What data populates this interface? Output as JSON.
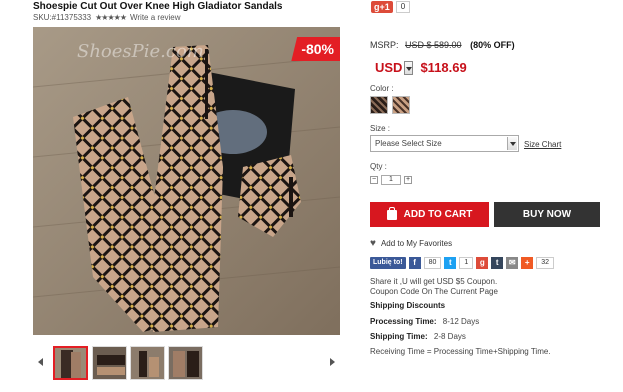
{
  "product": {
    "title": "Shoespie Cut Out Over Knee High Gladiator Sandals",
    "sku_label": "SKU:#11375333",
    "stars": "★★★★★",
    "review_link": "Write a review",
    "image_watermark": "ShoesPie.com",
    "discount_badge": "-80%"
  },
  "social_top": {
    "gplus_label": "g+1",
    "gplus_count": "0"
  },
  "pricing": {
    "msrp_label": "MSRP:",
    "msrp_price": "USD $ 589.00",
    "off_text": "(80% OFF)",
    "currency": "USD",
    "price": "$118.69"
  },
  "options": {
    "color_label": "Color :",
    "size_label": "Size :",
    "size_placeholder": "Please Select Size",
    "size_chart": "Size Chart",
    "qty_label": "Qty :",
    "qty_minus": "−",
    "qty_value": "1",
    "qty_plus": "+"
  },
  "actions": {
    "add_to_cart": "ADD TO CART",
    "buy_now": "BUY NOW",
    "favorite": "Add to My Favorites"
  },
  "social": {
    "fb_like": "Lubię to!",
    "fb_count": "80",
    "tw_count": "1",
    "share_count": "32"
  },
  "info": {
    "share_line1": "Share it ,U will get USD $5 Coupon.",
    "share_line2": "Coupon Code On The Current Page",
    "shipping_discounts": "Shipping Discounts",
    "processing_label": "Processing Time:",
    "processing_value": "8-12 Days",
    "shipping_label": "Shipping Time:",
    "shipping_value": "2-8 Days",
    "receiving": "Receiving Time = Processing Time+Shipping Time."
  },
  "colors": {
    "accent_red": "#d7171f",
    "dark_button": "#333333",
    "facebook": "#3b5998",
    "twitter": "#1da1f2",
    "gplus": "#dd4b39"
  }
}
